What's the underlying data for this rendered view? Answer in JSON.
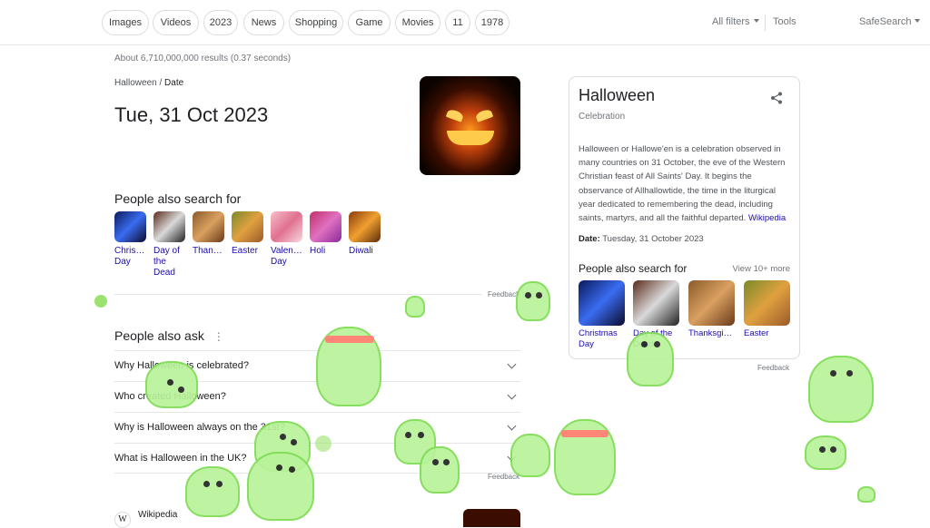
{
  "chips": [
    "Images",
    "Videos",
    "2023",
    "News",
    "Shopping",
    "Game",
    "Movies",
    "11",
    "1978"
  ],
  "tools": {
    "all_filters": "All filters",
    "tools": "Tools",
    "safesearch": "SafeSearch"
  },
  "results_stats": "About 6,710,000,000 results (0.37 seconds)",
  "breadcrumb": {
    "parent": "Halloween",
    "sep": "/",
    "current": "Date"
  },
  "answer_date": "Tue, 31 Oct 2023",
  "people_also_search": {
    "title": "People also search for",
    "items": [
      "Chris… Day",
      "Day of the Dead",
      "Than…",
      "Easter",
      "Valen… Day",
      "Holi",
      "Diwali"
    ],
    "feedback": "Feedback"
  },
  "people_also_ask": {
    "title": "People also ask",
    "questions": [
      "Why Halloween is celebrated?",
      "Who created Halloween?",
      "Why is Halloween always on the 31st?",
      "What is Halloween in the UK?"
    ],
    "feedback": "Feedback"
  },
  "wikipedia_label": "Wikipedia",
  "knowledge_panel": {
    "title": "Halloween",
    "subtitle": "Celebration",
    "description": "Halloween or Hallowe'en is a celebration observed in many countries on 31 October, the eve of the Western Christian feast of All Saints' Day. It begins the observance of Allhallowtide, the time in the liturgical year dedicated to remembering the dead, including saints, martyrs, and all the faithful departed.",
    "wiki_link": "Wikipedia",
    "date_label": "Date:",
    "date_value": "Tuesday, 31 October 2023",
    "pas_title": "People also search for",
    "view_more": "View 10+ more",
    "items": [
      "Christmas Day",
      "Day of the Dead",
      "Thanksgi…",
      "Easter"
    ],
    "feedback": "Feedback"
  },
  "colors": {
    "link": "#1a0dab",
    "ghost": "#b8f29a",
    "ghost_outline": "#7ddc52"
  }
}
